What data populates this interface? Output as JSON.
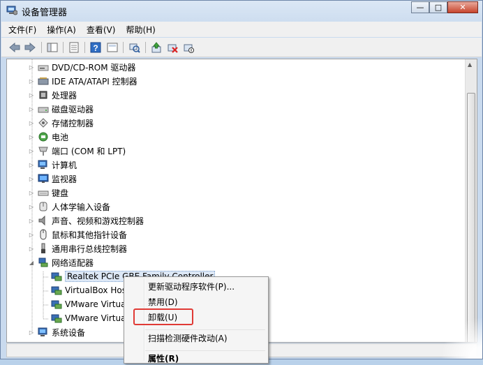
{
  "window": {
    "title": "设备管理器"
  },
  "caption_buttons": {
    "minimize": "—",
    "maximize": "□",
    "close": "✕"
  },
  "menu": [
    "文件(F)",
    "操作(A)",
    "查看(V)",
    "帮助(H)"
  ],
  "toolbar_icons": [
    "back-icon",
    "forward-icon",
    "show-hide-tree-icon",
    "properties-icon",
    "help-icon",
    "view-icon",
    "scan-hardware-icon",
    "update-driver-icon",
    "disable-device-icon",
    "uninstall-device-icon"
  ],
  "tree": [
    {
      "label": "DVD/CD-ROM 驱动器",
      "icon": "dvd-icon",
      "expanded": false
    },
    {
      "label": "IDE ATA/ATAPI 控制器",
      "icon": "ide-icon",
      "expanded": false
    },
    {
      "label": "处理器",
      "icon": "processor-icon",
      "expanded": false
    },
    {
      "label": "磁盘驱动器",
      "icon": "disk-icon",
      "expanded": false
    },
    {
      "label": "存储控制器",
      "icon": "storage-icon",
      "expanded": false
    },
    {
      "label": "电池",
      "icon": "battery-icon",
      "expanded": false
    },
    {
      "label": "端口 (COM 和 LPT)",
      "icon": "port-icon",
      "expanded": false
    },
    {
      "label": "计算机",
      "icon": "computer-icon",
      "expanded": false
    },
    {
      "label": "监视器",
      "icon": "monitor-icon",
      "expanded": false
    },
    {
      "label": "键盘",
      "icon": "keyboard-icon",
      "expanded": false
    },
    {
      "label": "人体学输入设备",
      "icon": "hid-icon",
      "expanded": false
    },
    {
      "label": "声音、视频和游戏控制器",
      "icon": "sound-icon",
      "expanded": false
    },
    {
      "label": "鼠标和其他指针设备",
      "icon": "mouse-icon",
      "expanded": false
    },
    {
      "label": "通用串行总线控制器",
      "icon": "usb-icon",
      "expanded": false
    },
    {
      "label": "网络适配器",
      "icon": "network-icon",
      "expanded": true
    }
  ],
  "network_children": [
    {
      "label": "Realtek PCIe GBE Family Controller",
      "selected": true
    },
    {
      "label": "VirtualBox Hos"
    },
    {
      "label": "VMware Virtua"
    },
    {
      "label": "VMware Virtua"
    }
  ],
  "last_category": {
    "label": "系统设备",
    "icon": "system-icon"
  },
  "context_menu": {
    "update_driver": "更新驱动程序软件(P)...",
    "disable": "禁用(D)",
    "uninstall": "卸载(U)",
    "scan": "扫描检测硬件改动(A)",
    "properties": "属性(R)"
  },
  "colors": {
    "highlight": "#e03a35",
    "selection": "#dde8f6"
  }
}
